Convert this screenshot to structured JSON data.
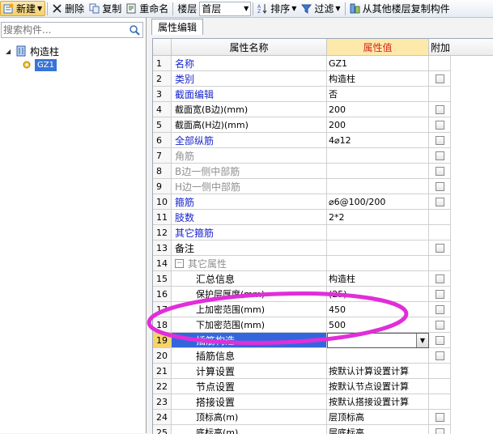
{
  "toolbar": {
    "new_label": "新建",
    "delete_label": "删除",
    "copy_label": "复制",
    "rename_label": "重命名",
    "floor_label": "楼层",
    "floor_value": "首层",
    "sort_label": "排序",
    "filter_label": "过滤",
    "copy_from_floor_label": "从其他楼层复制构件"
  },
  "left_panel": {
    "search_placeholder": "搜索构件...",
    "tree_root": "构造柱",
    "tree_child": "GZ1"
  },
  "right_panel": {
    "tab_label": "属性编辑",
    "headers": {
      "name": "属性名称",
      "value": "属性值",
      "add": "附加"
    },
    "rows": [
      {
        "num": "1",
        "name": "名称",
        "value": "GZ1",
        "color": "blue",
        "checkbox": false
      },
      {
        "num": "2",
        "name": "类别",
        "value": "构造柱",
        "color": "blue",
        "checkbox": true
      },
      {
        "num": "3",
        "name": "截面编辑",
        "value": "否",
        "color": "blue",
        "checkbox": false
      },
      {
        "num": "4",
        "name": "截面宽(B边)(mm)",
        "value": "200",
        "color": "black",
        "checkbox": true
      },
      {
        "num": "5",
        "name": "截面高(H边)(mm)",
        "value": "200",
        "color": "black",
        "checkbox": true
      },
      {
        "num": "6",
        "name": "全部纵筋",
        "value": "4⌀12",
        "color": "blue",
        "checkbox": true
      },
      {
        "num": "7",
        "name": "角筋",
        "value": "",
        "color": "gray",
        "checkbox": true
      },
      {
        "num": "8",
        "name": "B边一侧中部筋",
        "value": "",
        "color": "gray",
        "checkbox": true
      },
      {
        "num": "9",
        "name": "H边一侧中部筋",
        "value": "",
        "color": "gray",
        "checkbox": true
      },
      {
        "num": "10",
        "name": "箍筋",
        "value": "⌀6@100/200",
        "color": "blue",
        "checkbox": true
      },
      {
        "num": "11",
        "name": "肢数",
        "value": "2*2",
        "color": "blue",
        "checkbox": false
      },
      {
        "num": "12",
        "name": "其它箍筋",
        "value": "",
        "color": "blue",
        "checkbox": false
      },
      {
        "num": "13",
        "name": "备注",
        "value": "",
        "color": "black",
        "checkbox": true
      },
      {
        "num": "14",
        "name": "其它属性",
        "value": "",
        "color": "gray",
        "checkbox": false,
        "group": true
      },
      {
        "num": "15",
        "name": "汇总信息",
        "value": "构造柱",
        "color": "black",
        "checkbox": true,
        "indent": true
      },
      {
        "num": "16",
        "name": "保护层厚度(mm)",
        "value": "(25)",
        "color": "black",
        "checkbox": true,
        "indent": true
      },
      {
        "num": "17",
        "name": "上加密范围(mm)",
        "value": "450",
        "color": "black",
        "checkbox": true,
        "indent": true
      },
      {
        "num": "18",
        "name": "下加密范围(mm)",
        "value": "500",
        "color": "black",
        "checkbox": true,
        "indent": true
      },
      {
        "num": "19",
        "name": "插筋构造",
        "value": "",
        "color": "black",
        "checkbox": true,
        "indent": true,
        "selected": true
      },
      {
        "num": "20",
        "name": "插筋信息",
        "value": "",
        "color": "black",
        "checkbox": true,
        "indent": true
      },
      {
        "num": "21",
        "name": "计算设置",
        "value": "按默认计算设置计算",
        "color": "black",
        "checkbox": false,
        "indent": true
      },
      {
        "num": "22",
        "name": "节点设置",
        "value": "按默认节点设置计算",
        "color": "black",
        "checkbox": false,
        "indent": true
      },
      {
        "num": "23",
        "name": "搭接设置",
        "value": "按默认搭接设置计算",
        "color": "black",
        "checkbox": false,
        "indent": true
      },
      {
        "num": "24",
        "name": "顶标高(m)",
        "value": "层顶标高",
        "color": "black",
        "checkbox": true,
        "indent": true
      },
      {
        "num": "25",
        "name": "底标高(m)",
        "value": "层底标高",
        "color": "black",
        "checkbox": true,
        "indent": true
      }
    ]
  },
  "colors": {
    "accent_value_header": "#fde9a9",
    "value_header_text": "#d4261c",
    "selection_blue": "#3366dd",
    "annotation_magenta": "#e02ed8"
  }
}
